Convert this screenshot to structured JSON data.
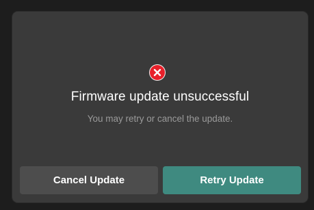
{
  "dialog": {
    "icon": "error-x-circle-icon",
    "title": "Firmware update unsuccessful",
    "subtitle": "You may retry or cancel the update.",
    "buttons": {
      "cancel_label": "Cancel Update",
      "retry_label": "Retry Update"
    }
  },
  "colors": {
    "dialog_bg": "#3a3a3a",
    "error_red": "#e8202a",
    "retry_accent": "#3f8a80",
    "cancel_bg": "#4d4d4d",
    "subtitle_text": "#9a9a9a"
  }
}
